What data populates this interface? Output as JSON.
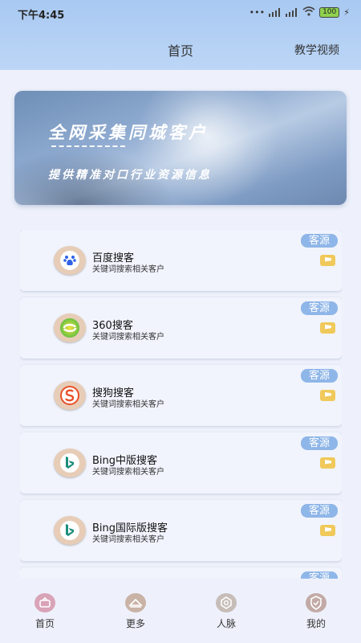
{
  "status_bar": {
    "time": "下午4:45",
    "network": "HD",
    "battery": "100"
  },
  "header": {
    "title": "首页",
    "tutorial_link": "教学视频"
  },
  "banner": {
    "title": "全网采集同城客户",
    "subtitle": "提供精准对口行业资源信息"
  },
  "cards": [
    {
      "title": "百度搜客",
      "subtitle": "关键词搜索相关客户",
      "badge": "客源",
      "icon": "baidu-icon"
    },
    {
      "title": "360搜客",
      "subtitle": "关键词搜索相关客户",
      "badge": "客源",
      "icon": "360-icon"
    },
    {
      "title": "搜狗搜客",
      "subtitle": "关键词搜索相关客户",
      "badge": "客源",
      "icon": "sogou-icon"
    },
    {
      "title": "Bing中版搜客",
      "subtitle": "关键词搜索相关客户",
      "badge": "客源",
      "icon": "bing-icon"
    },
    {
      "title": "Bing国际版搜客",
      "subtitle": "关键词搜索相关客户",
      "badge": "客源",
      "icon": "bing-icon"
    },
    {
      "title": "",
      "subtitle": "",
      "badge": "客源",
      "icon": ""
    }
  ],
  "bottom_nav": [
    {
      "label": "首页",
      "icon": "home-icon",
      "active": true
    },
    {
      "label": "更多",
      "icon": "more-icon"
    },
    {
      "label": "人脉",
      "icon": "contacts-icon"
    },
    {
      "label": "我的",
      "icon": "profile-icon"
    }
  ],
  "colors": {
    "header": "#a9c9f2",
    "badge": "#8fb6e8",
    "flag": "#f0c95a",
    "background": "#eef1fb",
    "active_nav": "#d9a3b8"
  }
}
